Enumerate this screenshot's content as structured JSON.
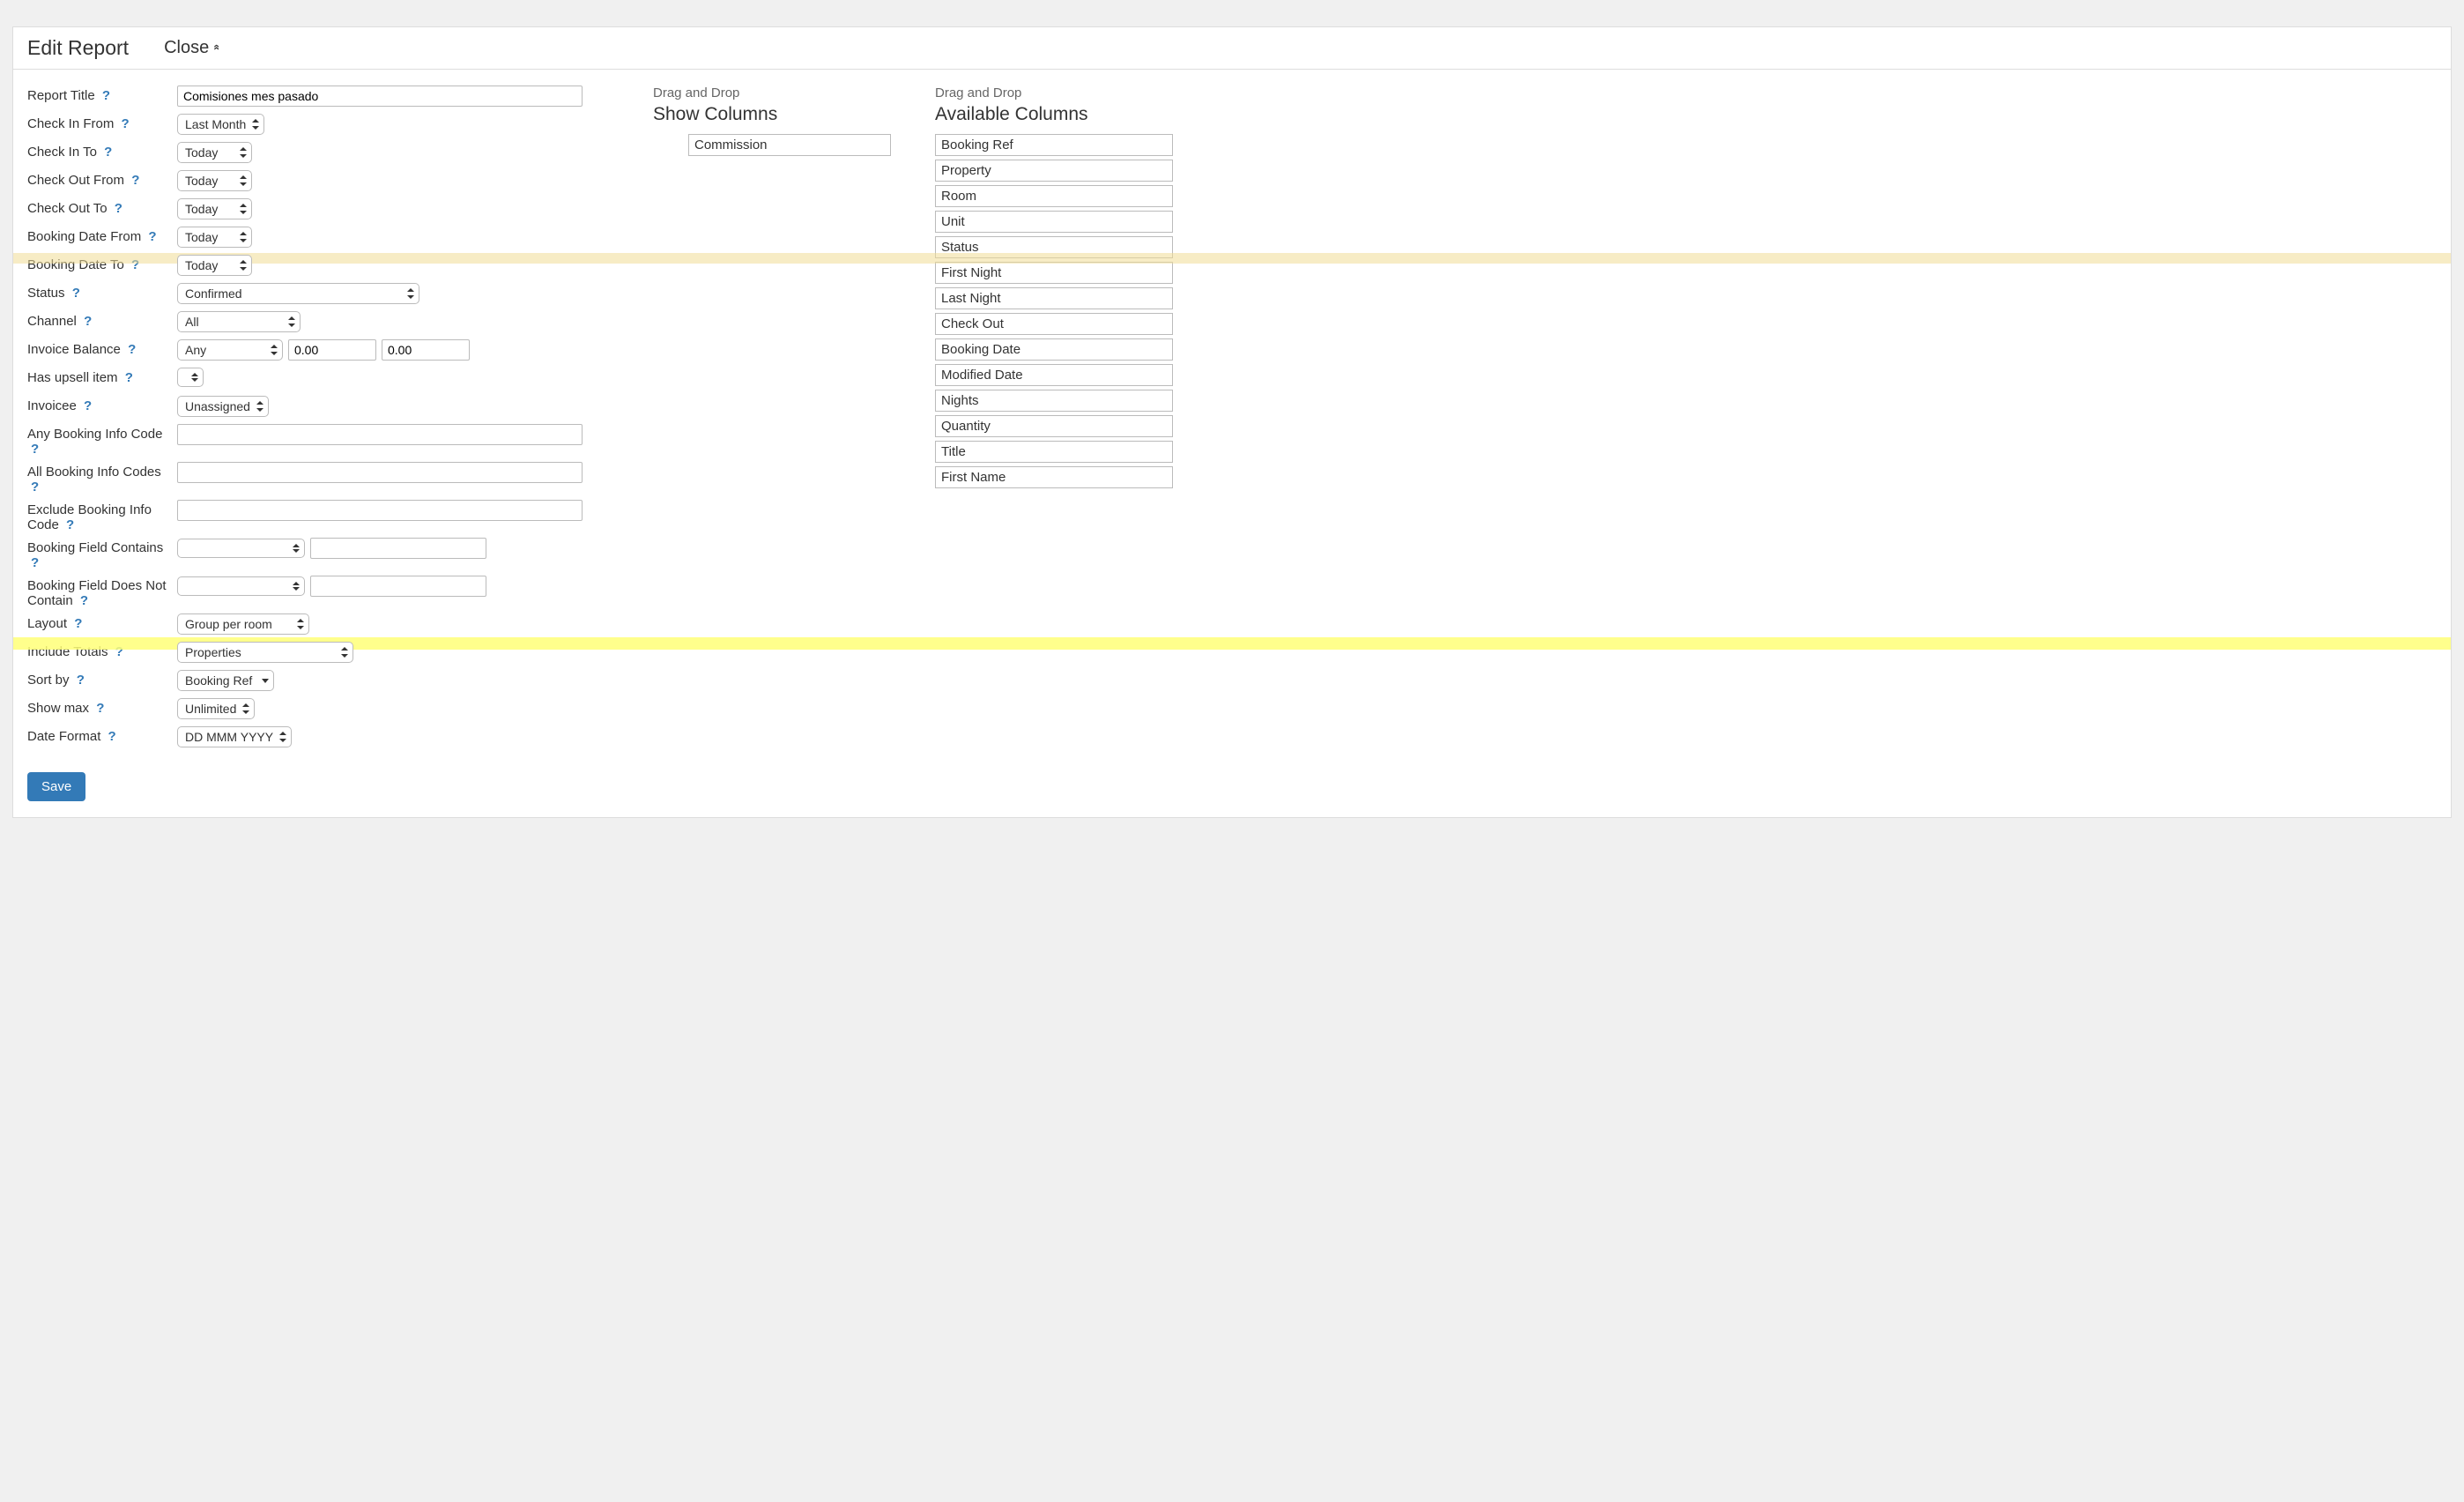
{
  "header": {
    "title": "Edit Report",
    "close": "Close"
  },
  "form": {
    "report_title_label": "Report Title",
    "report_title_value": "Comisiones mes pasado",
    "check_in_from_label": "Check In From",
    "check_in_from_value": "Last Month",
    "check_in_to_label": "Check In To",
    "check_in_to_value": "Today",
    "check_out_from_label": "Check Out From",
    "check_out_from_value": "Today",
    "check_out_to_label": "Check Out To",
    "check_out_to_value": "Today",
    "booking_date_from_label": "Booking Date From",
    "booking_date_from_value": "Today",
    "booking_date_to_label": "Booking Date To",
    "booking_date_to_value": "Today",
    "status_label": "Status",
    "status_value": "Confirmed",
    "channel_label": "Channel",
    "channel_value": "All",
    "invoice_balance_label": "Invoice Balance",
    "invoice_balance_select": "Any",
    "invoice_balance_v1": "0.00",
    "invoice_balance_v2": "0.00",
    "has_upsell_label": "Has upsell item",
    "has_upsell_value": "",
    "invoicee_label": "Invoicee",
    "invoicee_value": "Unassigned",
    "any_booking_info_label": "Any Booking Info Code",
    "any_booking_info_value": "",
    "all_booking_info_label": "All Booking Info Codes",
    "all_booking_info_value": "",
    "exclude_booking_info_label": "Exclude Booking Info Code",
    "exclude_booking_info_value": "",
    "booking_field_contains_label": "Booking Field Contains",
    "booking_field_contains_select": "",
    "booking_field_contains_value": "",
    "booking_field_not_label": "Booking Field Does Not Contain",
    "booking_field_not_select": "",
    "booking_field_not_value": "",
    "layout_label": "Layout",
    "layout_value": "Group per room",
    "include_totals_label": "Include Totals",
    "include_totals_value": "Properties",
    "sort_by_label": "Sort by",
    "sort_by_value": "Booking Ref",
    "show_max_label": "Show max",
    "show_max_value": "Unlimited",
    "date_format_label": "Date Format",
    "date_format_value": "DD MMM YYYY",
    "save_button": "Save",
    "help_icon": "?"
  },
  "columns": {
    "drag_label": "Drag and Drop",
    "show_title": "Show Columns",
    "available_title": "Available Columns",
    "show_items": [
      "Commission"
    ],
    "available_items": [
      "Booking Ref",
      "Property",
      "Room",
      "Unit",
      "Status",
      "First Night",
      "Last Night",
      "Check Out",
      "Booking Date",
      "Modified Date",
      "Nights",
      "Quantity",
      "Title",
      "First Name"
    ]
  }
}
